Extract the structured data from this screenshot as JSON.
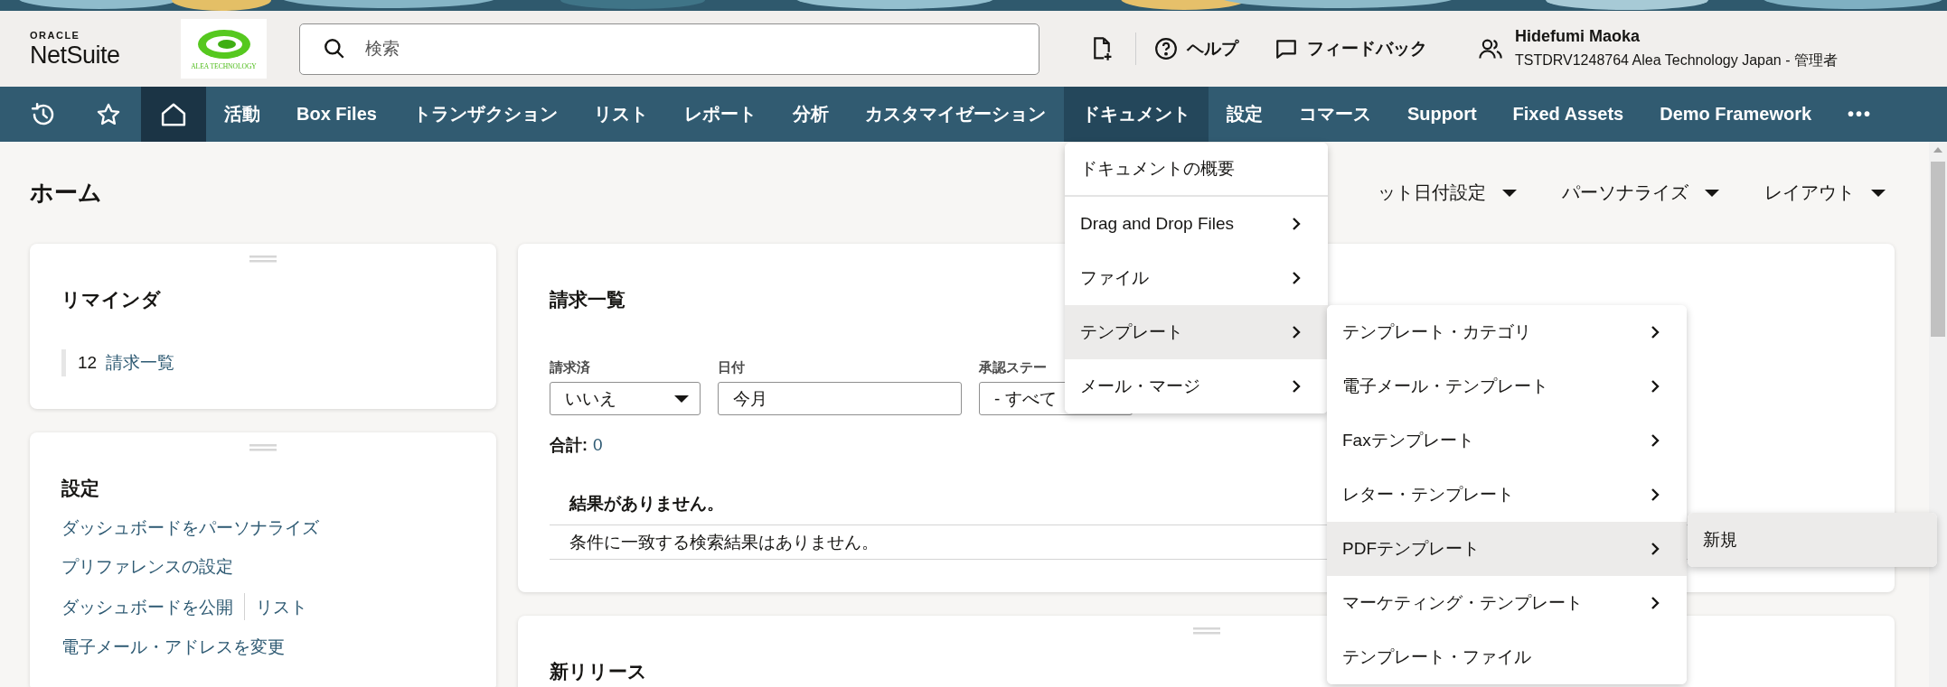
{
  "header": {
    "logo": {
      "line_1": "ORACLE",
      "line_2": "NetSuite"
    },
    "company_logo": {
      "text": "ALEA TECHNOLOGY"
    },
    "search": {
      "placeholder": "検索"
    },
    "actions": [
      {
        "kind": "new-document"
      },
      {
        "kind": "help",
        "label": "ヘルプ"
      },
      {
        "kind": "feedback",
        "label": "フィードバック"
      }
    ],
    "user": {
      "name": "Hidefumi Maoka",
      "account": "TSTDRV1248764 Alea Technology Japan - 管理者"
    }
  },
  "nav": {
    "items": [
      {
        "kind": "history",
        "selected": false,
        "expanded": false
      },
      {
        "kind": "favorites",
        "selected": false,
        "expanded": false
      },
      {
        "kind": "home",
        "selected": true,
        "expanded": false
      },
      {
        "kind": "text",
        "label": "活動",
        "selected": false,
        "expanded": false
      },
      {
        "kind": "text",
        "label": "Box Files",
        "selected": false,
        "expanded": false
      },
      {
        "kind": "text",
        "label": "トランザクション",
        "selected": false,
        "expanded": false
      },
      {
        "kind": "text",
        "label": "リスト",
        "selected": false,
        "expanded": false
      },
      {
        "kind": "text",
        "label": "レポート",
        "selected": false,
        "expanded": false
      },
      {
        "kind": "text",
        "label": "分析",
        "selected": false,
        "expanded": false
      },
      {
        "kind": "text",
        "label": "カスタマイゼーション",
        "selected": false,
        "expanded": false
      },
      {
        "kind": "text",
        "label": "ドキュメント",
        "selected": false,
        "expanded": true
      },
      {
        "kind": "text",
        "label": "設定",
        "selected": false,
        "expanded": false
      },
      {
        "kind": "text",
        "label": "コマース",
        "selected": false,
        "expanded": false
      },
      {
        "kind": "text",
        "label": "Support",
        "selected": false,
        "expanded": false
      },
      {
        "kind": "text",
        "label": "Fixed Assets",
        "selected": false,
        "expanded": false
      },
      {
        "kind": "text",
        "label": "Demo Framework",
        "selected": false,
        "expanded": false
      },
      {
        "kind": "more",
        "label": "•••",
        "selected": false,
        "expanded": false
      }
    ]
  },
  "page": {
    "title": "ホーム",
    "controls": [
      {
        "label": "ット日付設定"
      },
      {
        "label": "パーソナライズ"
      },
      {
        "label": "レイアウト"
      }
    ]
  },
  "left_portlets": [
    {
      "kind": "reminders",
      "handle": true,
      "title": "リマインダ",
      "reminders": [
        {
          "count": "12",
          "label": "請求一覧"
        }
      ]
    },
    {
      "kind": "links",
      "handle": true,
      "title": "設定",
      "rows": [
        {
          "links": [
            "ダッシュボードをパーソナライズ"
          ]
        },
        {
          "links": [
            "プリファレンスの設定"
          ]
        },
        {
          "links": [
            "ダッシュボードを公開",
            "リスト"
          ]
        },
        {
          "links": [
            "電子メール・アドレスを変更"
          ]
        }
      ]
    }
  ],
  "main_portlets": [
    {
      "kind": "search",
      "title": "請求一覧",
      "filters": [
        {
          "label": "請求済",
          "kind": "select",
          "value": "いいえ"
        },
        {
          "label": "日付",
          "kind": "text",
          "value": "今月"
        },
        {
          "label": "承認ステー",
          "kind": "text",
          "value": "- すべて"
        }
      ],
      "total_label": "合計:",
      "total": "0",
      "table": {
        "header": "結果がありません。",
        "rows": [
          "条件に一致する検索結果はありません。"
        ]
      }
    },
    {
      "kind": "empty",
      "handle": true,
      "title": "新リリース"
    }
  ],
  "menus": [
    {
      "items": [
        {
          "label": "ドキュメントの概要",
          "has_submenu": false,
          "divider_after": true,
          "selected": false
        },
        {
          "label": "Drag and Drop Files",
          "has_submenu": true,
          "divider_after": false,
          "selected": false
        },
        {
          "label": "ファイル",
          "has_submenu": true,
          "divider_after": false,
          "selected": false
        },
        {
          "label": "テンプレート",
          "has_submenu": true,
          "divider_after": false,
          "selected": true
        },
        {
          "label": "メール・マージ",
          "has_submenu": true,
          "divider_after": false,
          "selected": false
        }
      ]
    },
    {
      "items": [
        {
          "label": "テンプレート・カテゴリ",
          "has_submenu": true,
          "divider_after": false,
          "selected": false
        },
        {
          "label": "電子メール・テンプレート",
          "has_submenu": true,
          "divider_after": false,
          "selected": false
        },
        {
          "label": "Faxテンプレート",
          "has_submenu": true,
          "divider_after": false,
          "selected": false
        },
        {
          "label": "レター・テンプレート",
          "has_submenu": true,
          "divider_after": false,
          "selected": false
        },
        {
          "label": "PDFテンプレート",
          "has_submenu": true,
          "divider_after": false,
          "selected": true
        },
        {
          "label": "マーケティング・テンプレート",
          "has_submenu": true,
          "divider_after": false,
          "selected": false
        },
        {
          "label": "テンプレート・ファイル",
          "has_submenu": false,
          "divider_after": false,
          "selected": false
        }
      ]
    },
    {
      "items": [
        {
          "label": "新規",
          "has_submenu": false,
          "divider_after": false,
          "selected": true
        }
      ]
    }
  ]
}
